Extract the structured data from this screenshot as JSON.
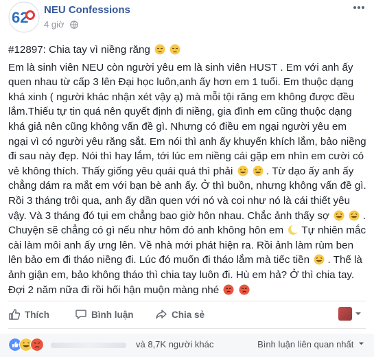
{
  "header": {
    "page_name": "NEU Confessions",
    "timestamp": "4 giờ",
    "avatar_number": "62"
  },
  "post": {
    "title": "#12897: Chia tay vì niềng răng",
    "seg1": "Em là sinh viên NEU còn người yêu em là sinh viên HUST . Em với anh ấy quen nhau từ cấp 3 lên Đại học luôn,anh ấy hơn em 1 tuổi. Em thuộc dạng khá xinh ( người khác nhận xét vậy ạ) mà mỗi tội răng em không được đều lắm.Thiếu tự tin quá nên quyết định đi niềng, gia đình em cũng thuộc dạng khá giả nên cũng không vấn đề gì. Nhưng có điều em ngại người yêu em ngại vì có người yêu răng sắt. Em nói thì anh ấy khuyến khích lắm, bảo niềng đi sau này đẹp. Nói thì hay lắm, tới lúc em niềng cái gặp em nhìn em cười có vẻ không thích. Thấy giống yêu quái quá thì phải",
    "seg2": ". Từ dạo ấy anh ấy chẳng dám ra mắt em với bạn bè anh ấy. Ở thì buồn, nhưng không vấn đề gì. Rồi 3 tháng trôi qua, anh ấy dần quen với nó và coi như nó là cái thiết yêu vậy. Và 3 tháng đó tụi em chẳng bao giờ hôn nhau. Chắc ảnh thấy sợ",
    "seg3": ". Chuyện sẽ chẳng có gì nếu như hôm đó anh không hôn em",
    "seg4": "Tự nhiên mắc cài làm môi anh ấy ưng lên. Về nhà mới phát hiện ra. Rồi ảnh làm rùm ben lên bảo em đi tháo niềng đi. Lúc đó muốn đi tháo lắm mà tiếc tiền",
    "seg5": ". Thế là ảnh giận em, bảo không tháo thì chia tay luôn đi. Hù em hả? Ở thì chia tay. Đợi 2 năm nữa đi rồi hối hận muộn màng nhé"
  },
  "actions": {
    "like_label": "Thích",
    "comment_label": "Bình luận",
    "share_label": "Chia sẻ"
  },
  "footer": {
    "others_text": "và 8,7K người khác",
    "sort_label": "Bình luận liên quan nhất"
  },
  "colors": {
    "link": "#365899",
    "like_blue": "#5890ff",
    "haha_yellow": "#f7c948",
    "angry_red": "#e9573f"
  },
  "icons": [
    "globe-icon",
    "more-options-icon",
    "unamused-emoji",
    "laughing-emoji",
    "moon-emoji",
    "angry-emoji",
    "like-icon",
    "comment-icon",
    "share-icon",
    "chevron-down-icon"
  ]
}
